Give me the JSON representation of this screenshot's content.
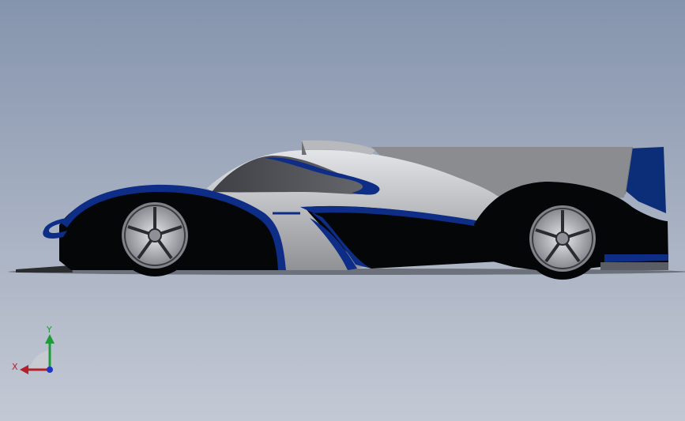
{
  "viewport": {
    "background_top": "#8594ad",
    "background_bottom": "#c3c9d4"
  },
  "model": {
    "type": "race car side view",
    "colors": {
      "body_black": "#050608",
      "accent_blue": "#0d2d86",
      "body_silver": "#a9abaf",
      "canopy_dark": "#4f5157",
      "rim": "#c9ccd1"
    }
  },
  "triad": {
    "x_label": "X",
    "y_label": "Y",
    "x_color": "#b0212b",
    "y_color": "#1f9a3a",
    "z_color": "#1c35c9"
  }
}
